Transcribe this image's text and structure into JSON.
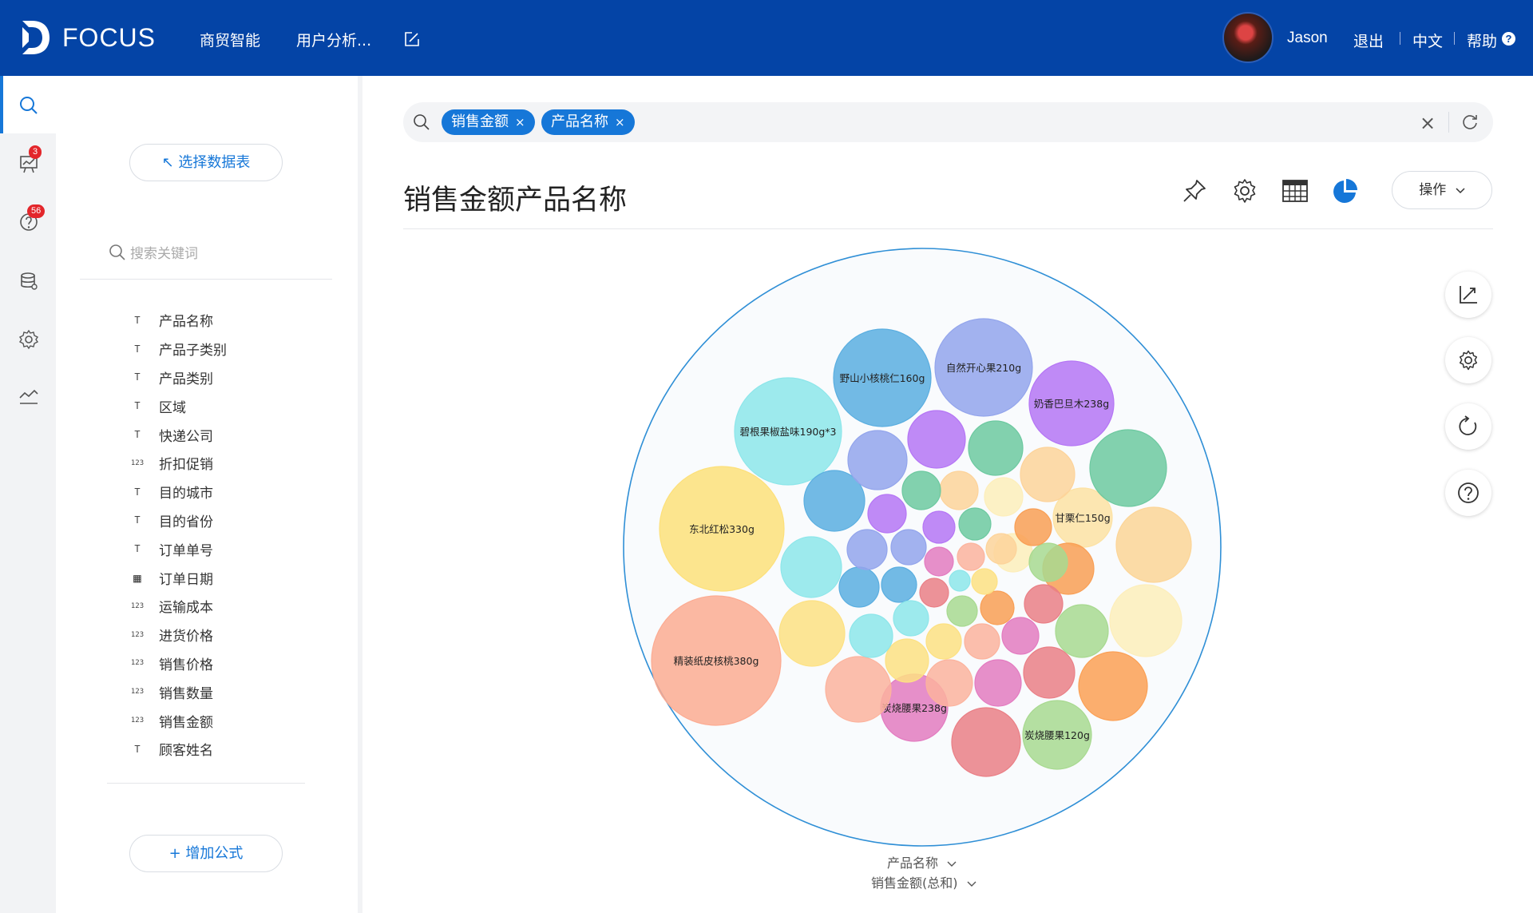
{
  "header": {
    "logo_text": "FOCUS",
    "nav": [
      "商贸智能",
      "用户分析..."
    ],
    "user_name": "Jason",
    "logout": "退出",
    "language": "中文",
    "help": "帮助",
    "help_icon_glyph": "?"
  },
  "rail": {
    "badges": {
      "alerts": "3",
      "questions": "56"
    }
  },
  "panel": {
    "select_table": "↖ 选择数据表",
    "search_placeholder": "搜索关键词",
    "add_formula": "+ 增加公式",
    "fields": [
      {
        "name": "产品名称",
        "type": "text"
      },
      {
        "name": "产品子类别",
        "type": "text"
      },
      {
        "name": "产品类别",
        "type": "text"
      },
      {
        "name": "区域",
        "type": "text"
      },
      {
        "name": "快递公司",
        "type": "text"
      },
      {
        "name": "折扣促销",
        "type": "number"
      },
      {
        "name": "目的城市",
        "type": "text"
      },
      {
        "name": "目的省份",
        "type": "text"
      },
      {
        "name": "订单单号",
        "type": "text"
      },
      {
        "name": "订单日期",
        "type": "date"
      },
      {
        "name": "运输成本",
        "type": "number"
      },
      {
        "name": "进货价格",
        "type": "number"
      },
      {
        "name": "销售价格",
        "type": "number"
      },
      {
        "name": "销售数量",
        "type": "number"
      },
      {
        "name": "销售金额",
        "type": "number"
      },
      {
        "name": "顾客姓名",
        "type": "text"
      }
    ]
  },
  "search": {
    "tags": [
      "销售金额",
      "产品名称"
    ],
    "tag_close": "×",
    "clear": "×"
  },
  "main": {
    "title": "销售金额产品名称",
    "ops_label": "操作",
    "x_axis_label": "产品名称",
    "y_axis_label": "销售金额(总和)"
  },
  "colors": {
    "brand": "#0444a6",
    "accent": "#1677d8"
  },
  "chart_data": {
    "type": "bubble",
    "label_field": "产品名称",
    "value_field": "销售金额(总和)",
    "labeled_bubbles": [
      "东北红松330g",
      "精装纸皮核桃380g",
      "碧根果椒盐味190g*3",
      "野山小核桃仁160g",
      "自然开心果210g",
      "奶香巴旦木238g",
      "甘栗仁150g",
      "炭烧腰果238g",
      "炭烧腰果120g"
    ]
  }
}
